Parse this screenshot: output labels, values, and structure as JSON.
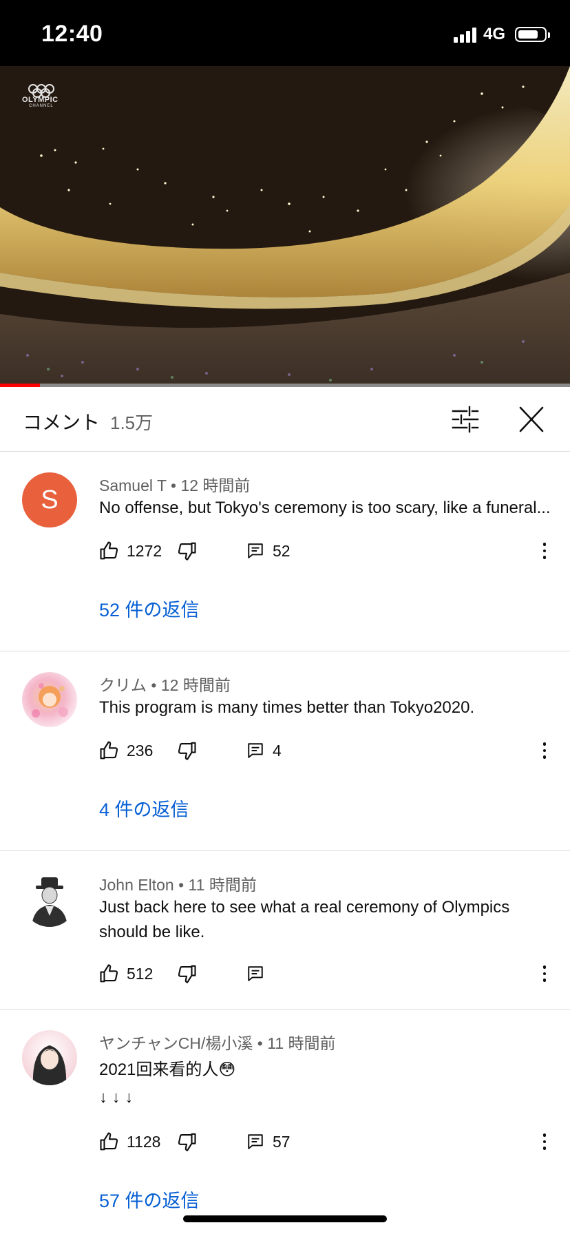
{
  "status_bar": {
    "time": "12:40",
    "network": "4G"
  },
  "video": {
    "channel_logo_text": "OLYMPIC",
    "channel_logo_subtext": "CHANNEL",
    "progress_percent": 7
  },
  "header": {
    "title": "コメント",
    "count": "1.5万"
  },
  "comments": [
    {
      "author": "Samuel T",
      "time": "12 時間前",
      "avatar_letter": "S",
      "avatar_color": "#e8603c",
      "text": "No offense, but Tokyo's ceremony is too scary, like a funeral...",
      "likes": "1272",
      "replies": "52",
      "replies_link": "52 件の返信"
    },
    {
      "author": "クリム",
      "time": "12 時間前",
      "text": "This program is many times better than Tokyo2020.",
      "likes": "236",
      "replies": "4",
      "replies_link": "4 件の返信"
    },
    {
      "author": "John Elton",
      "time": "11 時間前",
      "text": "Just back here to see what a real ceremony of Olympics should be like.",
      "likes": "512",
      "replies": ""
    },
    {
      "author": "ヤンチャンCH/楊小溪",
      "time": "11 時間前",
      "text_line1": "2021回来看的人😳",
      "text_line2": "↓ ↓ ↓",
      "likes": "1128",
      "replies": "57",
      "replies_link": "57 件の返信"
    }
  ],
  "colors": {
    "link": "#065fd4",
    "progress": "#ff0000",
    "secondary_text": "#606060"
  },
  "icons": [
    "like-icon",
    "dislike-icon",
    "reply-icon",
    "more-vert-icon",
    "filter-icon",
    "close-icon"
  ]
}
